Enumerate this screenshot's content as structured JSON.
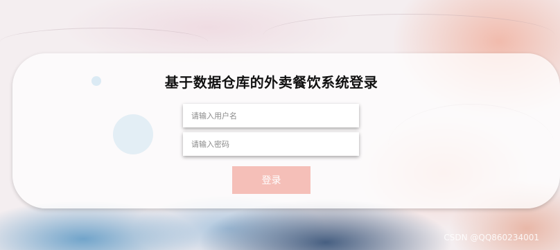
{
  "login": {
    "title": "基于数据仓库的外卖餐饮系统登录",
    "username_placeholder": "请输入用户名",
    "password_placeholder": "请输入密码",
    "submit_label": "登录"
  },
  "watermark": "CSDN @QQ860234001",
  "colors": {
    "button": "#f5bfb8",
    "button_text": "#ffffff",
    "title": "#111111"
  }
}
